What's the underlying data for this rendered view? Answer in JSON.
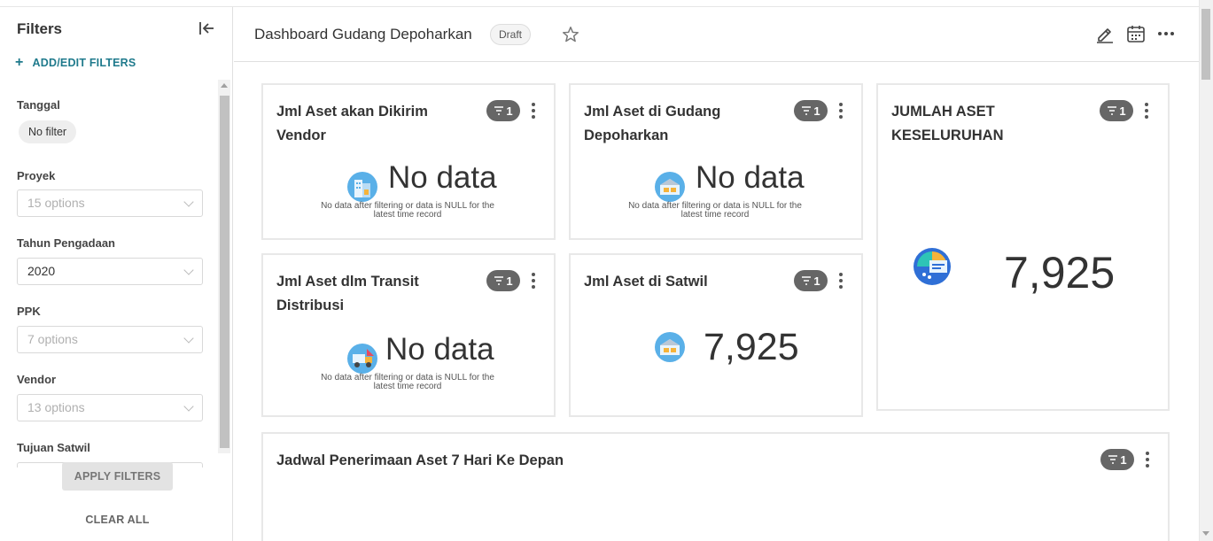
{
  "sidebar": {
    "title": "Filters",
    "add_filters_label": "ADD/EDIT FILTERS",
    "filters": [
      {
        "label": "Tanggal",
        "value": "No filter"
      },
      {
        "label": "Proyek",
        "value": "15 options"
      },
      {
        "label": "Tahun Pengadaan",
        "value": "2020"
      },
      {
        "label": "PPK",
        "value": "7 options"
      },
      {
        "label": "Vendor",
        "value": "13 options"
      },
      {
        "label": "Tujuan Satwil",
        "value": ""
      }
    ],
    "apply_label": "APPLY FILTERS",
    "clear_label": "CLEAR ALL"
  },
  "header": {
    "title": "Dashboard Gudang Depoharkan",
    "badge": "Draft"
  },
  "cards": [
    {
      "title_line1": "Jml Aset akan Dikirim",
      "title_line2": "Vendor",
      "filter_count": "1",
      "value": "No data",
      "note_line1": "No data after filtering or data is NULL for the",
      "note_line2": "latest time record",
      "icon": "building-icon"
    },
    {
      "title_line1": "Jml Aset di Gudang",
      "title_line2": "Depoharkan",
      "filter_count": "1",
      "value": "No data",
      "note_line1": "No data after filtering or data is NULL for the",
      "note_line2": "latest time record",
      "icon": "warehouse-icon"
    },
    {
      "title_line1": "JUMLAH ASET",
      "title_line2": "KESELURUHAN",
      "filter_count": "1",
      "value": "7,925",
      "icon": "dashboard-icon"
    },
    {
      "title_line1": "Jml Aset dlm Transit",
      "title_line2": "Distribusi",
      "filter_count": "1",
      "value": "No data",
      "note_line1": "No data after filtering or data is NULL for the",
      "note_line2": "latest time record",
      "icon": "truck-icon"
    },
    {
      "title_line1": "Jml Aset di Satwil",
      "filter_count": "1",
      "value": "7,925",
      "icon": "warehouse-icon"
    },
    {
      "title_line1": "Jadwal Penerimaan Aset 7 Hari Ke Depan",
      "filter_count": "1"
    }
  ],
  "colors": {
    "accent": "#1f7a8c",
    "pill": "#666666",
    "border": "#e8e8e8"
  }
}
